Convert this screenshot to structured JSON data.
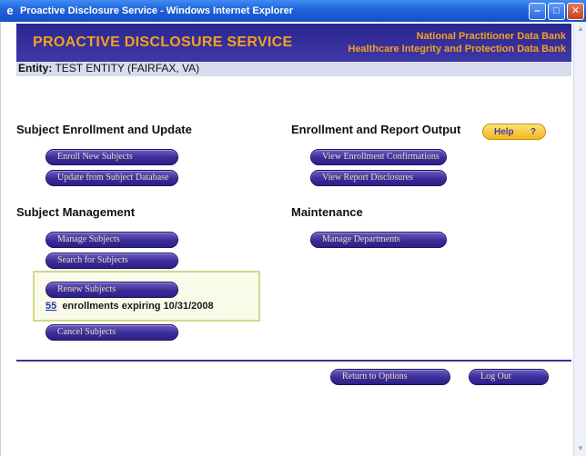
{
  "window": {
    "title": "Proactive Disclosure Service - Windows Internet Explorer",
    "icon": "ie-logo-icon",
    "controls": [
      "minimize-icon",
      "maximize-icon",
      "close-icon"
    ]
  },
  "banner": {
    "brand": "PROACTIVE DISCLOSURE SERVICE",
    "org_line1": "National Practitioner Data Bank",
    "org_line2": "Healthcare Integrity and Protection Data Bank"
  },
  "entity": {
    "label": "Entity:",
    "value": "TEST ENTITY (FAIRFAX, VA)"
  },
  "sections": {
    "enrollment_update": {
      "heading": "Subject Enrollment and Update",
      "buttons": [
        "Enroll New Subjects",
        "Update from Subject Database"
      ]
    },
    "enrollment_output": {
      "heading": "Enrollment and Report Output",
      "buttons": [
        "View Enrollment Confirmations",
        "View Report Disclosures"
      ]
    },
    "subject_management": {
      "heading": "Subject Management",
      "buttons": [
        "Manage Subjects",
        "Search for Subjects",
        "Renew Subjects",
        "Cancel Subjects"
      ]
    },
    "maintenance": {
      "heading": "Maintenance",
      "buttons": [
        "Manage Departments"
      ]
    }
  },
  "renewal_notice": {
    "count": "55",
    "text": "enrollments expiring 10/31/2008"
  },
  "help": {
    "label": "Help",
    "icon_glyph": "?"
  },
  "footer": {
    "return_label": "Return to Options",
    "logout_label": "Log Out"
  },
  "colors": {
    "banner_bg": "#2c2690",
    "banner_text": "#f4a020",
    "button_bg": "#3b2d99",
    "button_text": "#f0dcb8",
    "entity_bar": "#d9dcec",
    "renew_highlight": "#fafae8",
    "help_bg": "#f3b71d"
  }
}
